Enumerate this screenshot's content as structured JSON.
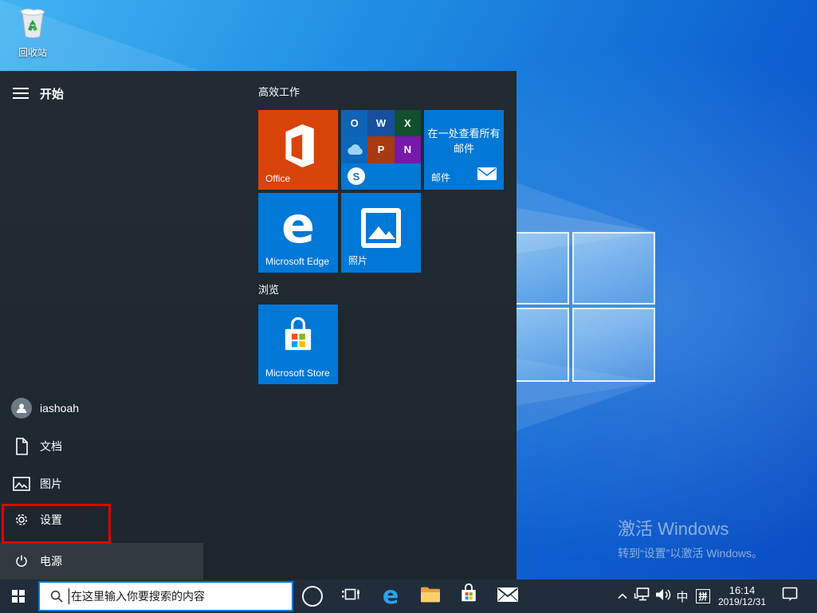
{
  "desktop": {
    "recycle_bin": {
      "label": "回收站"
    },
    "watermark": {
      "title": "激活 Windows",
      "subtitle": "转到“设置”以激活 Windows。"
    }
  },
  "start_menu": {
    "title": "开始",
    "rail": [
      {
        "label": "iashoah"
      },
      {
        "label": "文档"
      },
      {
        "label": "图片"
      },
      {
        "label": "设置"
      },
      {
        "label": "电源"
      }
    ],
    "groups": [
      {
        "title": "高效工作"
      },
      {
        "title": "浏览"
      }
    ],
    "tiles": {
      "office": {
        "label": "Office"
      },
      "mini_letters": {
        "outlook": "O",
        "word": "W",
        "excel": "X",
        "powerpoint": "P",
        "onenote": "N",
        "skype": "S"
      },
      "mail": {
        "line1": "在一处查看所有",
        "line2": "邮件",
        "label": "邮件"
      },
      "edge": {
        "label": "Microsoft Edge",
        "letter": "e"
      },
      "photos": {
        "label": "照片"
      },
      "store": {
        "label": "Microsoft Store"
      }
    }
  },
  "taskbar": {
    "search": {
      "placeholder": "在这里输入你要搜索的内容"
    },
    "edge_letter": "e",
    "tray": {
      "ime_lang": "中",
      "ime_mode": "拼",
      "time": "16:14",
      "date": "2019/12/31"
    }
  },
  "colors": {
    "tile_blue": "#0078d7",
    "office_orange": "#d8430a",
    "menu_bg": "#1f2a31",
    "taskbar_bg": "#212d3b",
    "annotation_red": "#e10000",
    "wallpaper_deep": "#0a4cc2",
    "wallpaper_light": "#41b3f2"
  }
}
